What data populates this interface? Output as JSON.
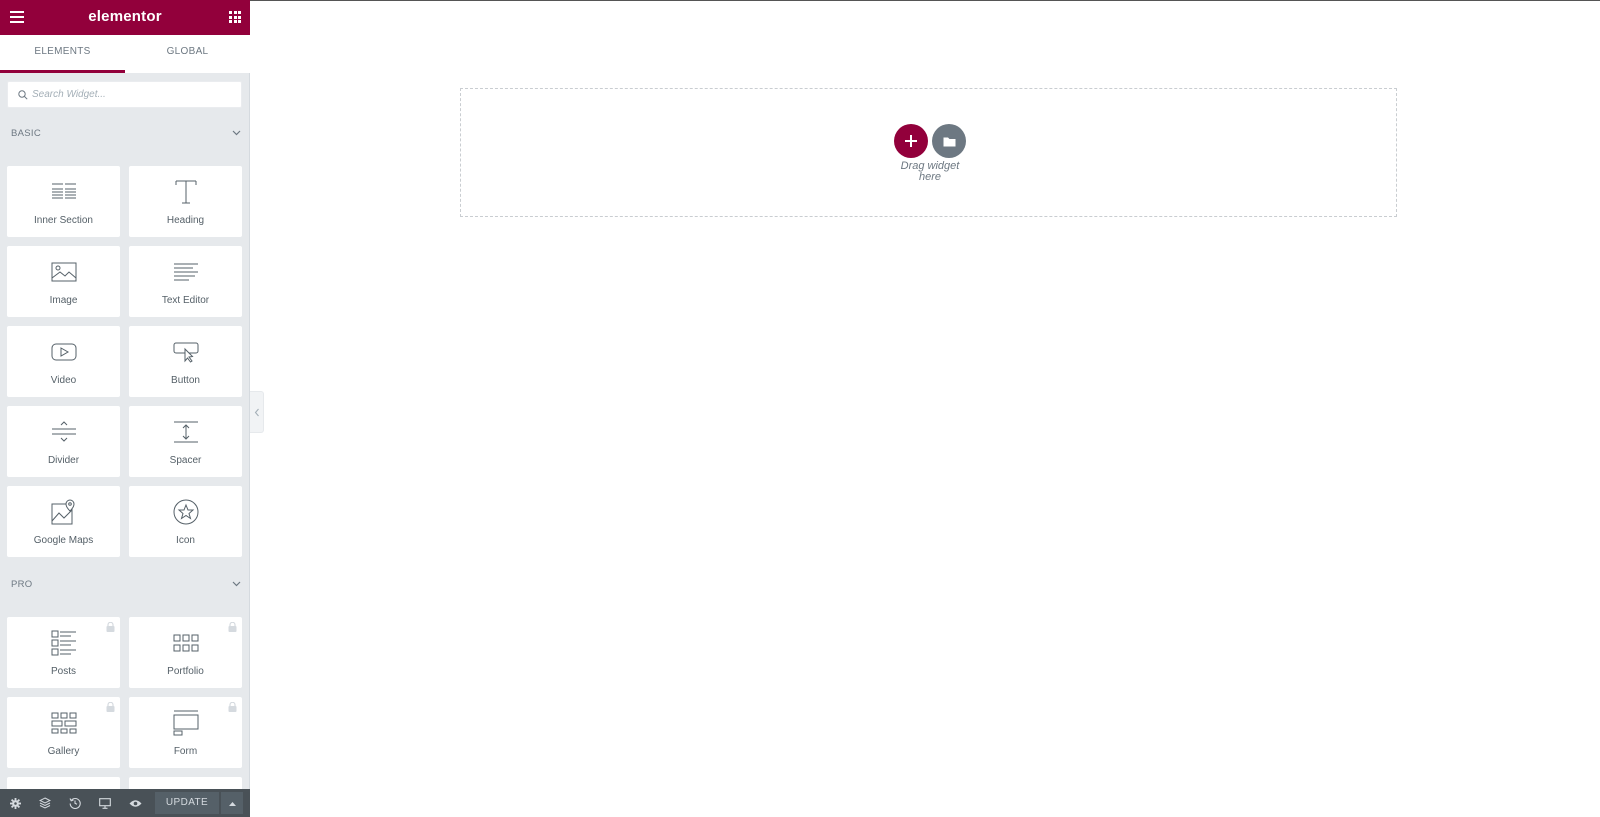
{
  "header": {
    "logo": "elementor",
    "brand_color": "#92003b"
  },
  "tabs": [
    {
      "label": "ELEMENTS",
      "active": true
    },
    {
      "label": "GLOBAL",
      "active": false
    }
  ],
  "search": {
    "placeholder": "Search Widget..."
  },
  "categories": {
    "basic": {
      "title": "BASIC",
      "widgets": [
        {
          "title": "Inner Section",
          "icon": "inner-section-icon"
        },
        {
          "title": "Heading",
          "icon": "heading-icon"
        },
        {
          "title": "Image",
          "icon": "image-icon"
        },
        {
          "title": "Text Editor",
          "icon": "text-editor-icon"
        },
        {
          "title": "Video",
          "icon": "video-icon"
        },
        {
          "title": "Button",
          "icon": "button-icon"
        },
        {
          "title": "Divider",
          "icon": "divider-icon"
        },
        {
          "title": "Spacer",
          "icon": "spacer-icon"
        },
        {
          "title": "Google Maps",
          "icon": "google-maps-icon"
        },
        {
          "title": "Icon",
          "icon": "star-icon"
        }
      ]
    },
    "pro": {
      "title": "PRO",
      "widgets": [
        {
          "title": "Posts",
          "icon": "posts-icon",
          "locked": true
        },
        {
          "title": "Portfolio",
          "icon": "portfolio-icon",
          "locked": true
        },
        {
          "title": "Gallery",
          "icon": "gallery-icon",
          "locked": true
        },
        {
          "title": "Form",
          "icon": "form-icon",
          "locked": true
        }
      ]
    }
  },
  "footer": {
    "icons": [
      "settings-icon",
      "navigator-icon",
      "history-icon",
      "responsive-icon",
      "preview-icon"
    ],
    "update_label": "UPDATE"
  },
  "canvas": {
    "drop_text_line1": "Drag widget",
    "drop_text_line2": "here"
  }
}
